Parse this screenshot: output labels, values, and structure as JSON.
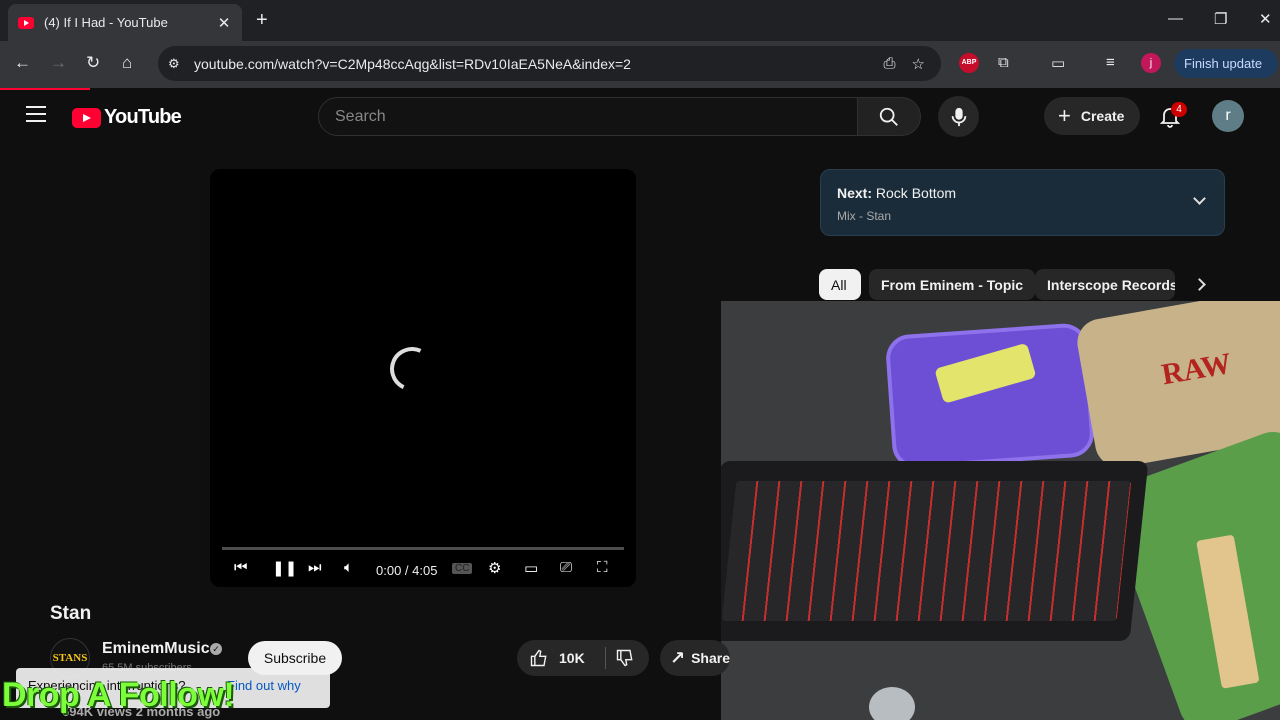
{
  "browser": {
    "tab_title": "(4) If I Had - YouTube",
    "new_tab": "+",
    "url": "youtube.com/watch?v=C2Mp48ccAqg&list=RDv10IaEA5NeA&index=2",
    "extension_abp": "ABP",
    "profile_initial": "j",
    "finish_update_label": "Finish update"
  },
  "masthead": {
    "logo_text": "YouTube",
    "search_placeholder": "Search",
    "create_label": "Create",
    "notification_count": "4",
    "avatar_initial": "r"
  },
  "player": {
    "time": "0:00 / 4:05",
    "progress_fraction": 0
  },
  "next_up": {
    "prefix": "Next:",
    "title": "Rock Bottom",
    "subtitle": "Mix - Stan"
  },
  "chips": [
    {
      "label": "All",
      "active": true
    },
    {
      "label": "From Eminem - Topic",
      "active": false
    },
    {
      "label": "Interscope Records",
      "active": false
    }
  ],
  "webcam": {
    "tray_brand": "RAW"
  },
  "video": {
    "title": "Stan",
    "channel_avatar_text": "STANS",
    "channel_name": "EminemMusic",
    "subscribers": "65.5M subscribers",
    "subscribe_label": "Subscribe",
    "likes": "10K",
    "share_label": "Share",
    "views": "694K views  2 months ago"
  },
  "toast": {
    "message": "Experiencing interruptions?",
    "link": "Find out why"
  },
  "overlay_text": "Drop A Follow!",
  "colors": {
    "accent_red": "#ff0033",
    "overlay_green": "#7cff3a"
  }
}
